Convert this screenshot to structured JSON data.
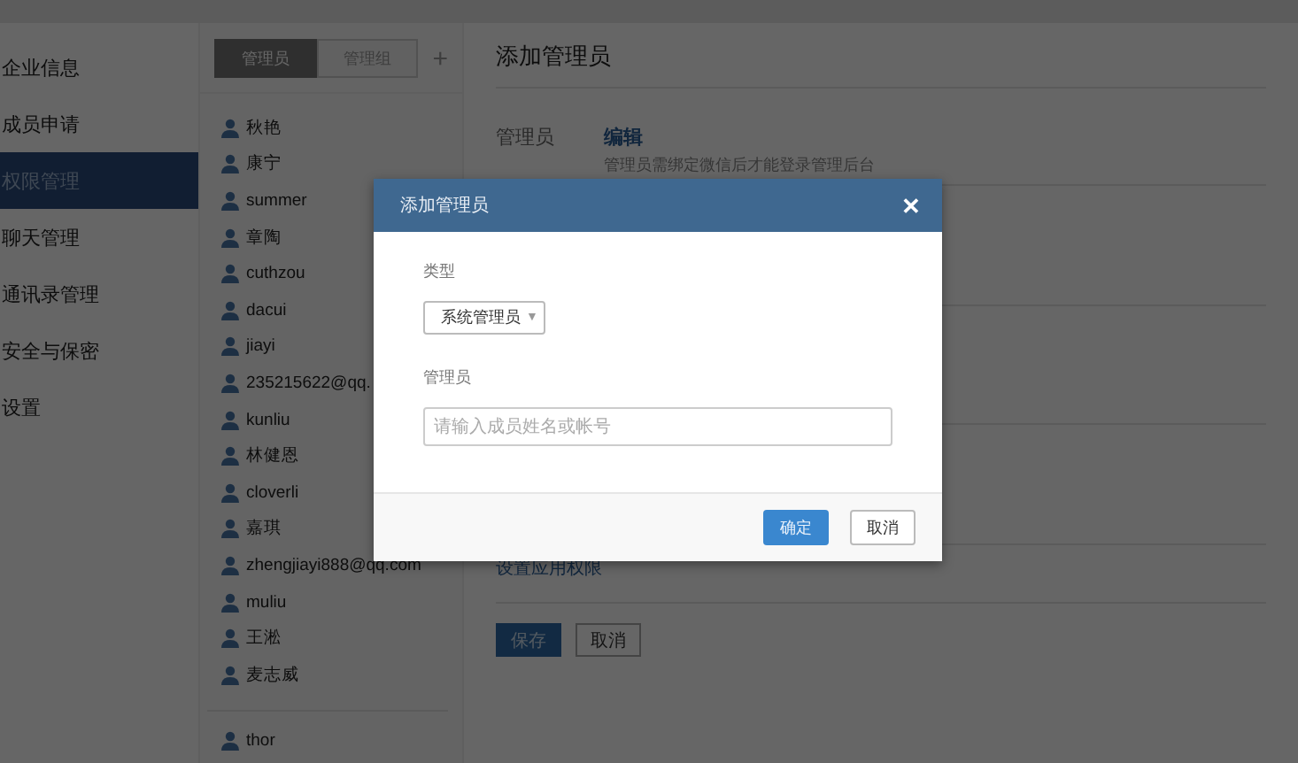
{
  "nav": [
    {
      "label": "企业信息",
      "selected": false
    },
    {
      "label": "成员申请",
      "selected": false
    },
    {
      "label": "权限管理",
      "selected": true
    },
    {
      "label": "聊天管理",
      "selected": false
    },
    {
      "label": "通讯录管理",
      "selected": false
    },
    {
      "label": "安全与保密",
      "selected": false
    },
    {
      "label": "设置",
      "selected": false
    }
  ],
  "member_tabs": [
    {
      "label": "管理员",
      "selected": true
    },
    {
      "label": "管理组",
      "selected": false
    }
  ],
  "add_button": "+",
  "members": [
    "秋艳",
    "康宁",
    "summer",
    "章陶",
    "cuthzou",
    "dacui",
    "jiayi",
    "235215622@qq.",
    "kunliu",
    "林健恩",
    "cloverli",
    "嘉琪",
    "zhengjiayi888@qq.com",
    "muliu",
    "王淞",
    "麦志威"
  ],
  "other_members": [
    "thor"
  ],
  "panel": {
    "title": "添加管理员",
    "field_label": "管理员",
    "edit_link": "编辑",
    "description": "管理员需绑定微信后才能登录管理后台",
    "permission_link": "设置应用权限",
    "save_button": "保存",
    "cancel_button": "取消"
  },
  "dialog": {
    "title": "添加管理员",
    "close": "✕",
    "type_label": "类型",
    "type_value": "系统管理员",
    "type_caret": "▼",
    "admin_label": "管理员",
    "admin_placeholder": "请输入成员姓名或帐号",
    "ok_button": "确定",
    "cancel_button": "取消"
  }
}
